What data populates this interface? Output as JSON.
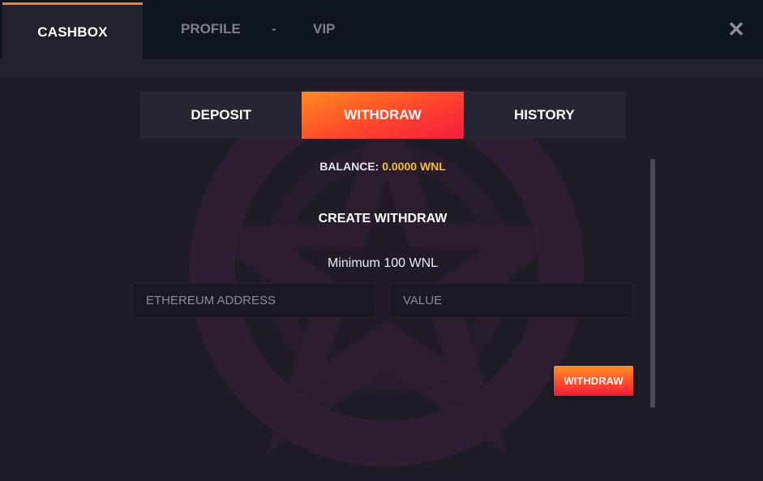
{
  "top_nav": {
    "tabs": [
      {
        "label": "CASHBOX",
        "active": true
      },
      {
        "label": "PROFILE",
        "active": false
      },
      {
        "label": "-",
        "active": false
      },
      {
        "label": "VIP",
        "active": false
      }
    ],
    "close_icon": "close-icon"
  },
  "sub_tabs": [
    {
      "label": "DEPOSIT",
      "active": false
    },
    {
      "label": "WITHDRAW",
      "active": true
    },
    {
      "label": "HISTORY",
      "active": false
    }
  ],
  "balance": {
    "label": "BALANCE:",
    "amount": "0.0000 WNL"
  },
  "withdraw_form": {
    "title": "CREATE WITHDRAW",
    "minimum": "Minimum 100 WNL",
    "address_placeholder": "ETHEREUM ADDRESS",
    "value_placeholder": "VALUE",
    "submit_label": "WITHDRAW"
  },
  "colors": {
    "accent_orange": "#f5821f",
    "accent_red": "#f21e3e",
    "balance_amount": "#f6c22b",
    "background": "#1e1c25",
    "nav_background": "#0f151e"
  }
}
